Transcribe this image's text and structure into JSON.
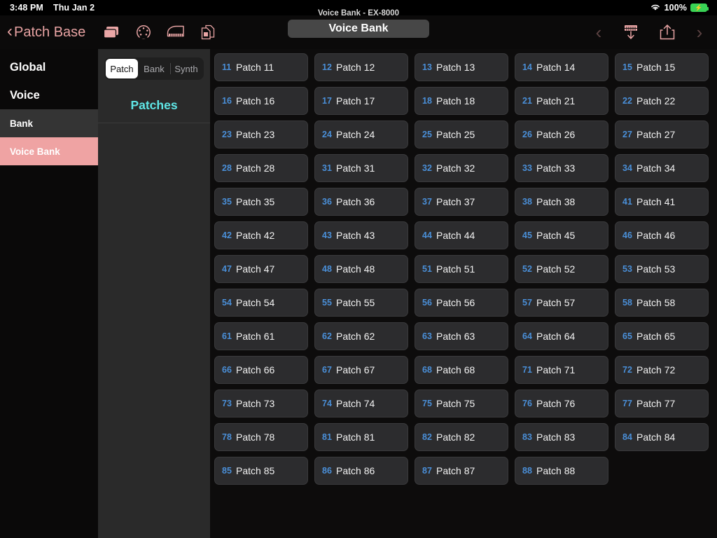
{
  "statusbar": {
    "time": "3:48 PM",
    "date": "Thu Jan 2",
    "wifi_icon": "wifi-icon",
    "battery_percent": "100%",
    "battery_icon": "battery-charging-icon",
    "battery_color": "#39d355"
  },
  "navbar": {
    "back_chevron": "‹",
    "back_label": "Patch Base",
    "back_color": "#e8a3a3",
    "icons": [
      {
        "name": "bank-cards-icon",
        "label": "Banks"
      },
      {
        "name": "midi-din-icon",
        "label": "MIDI"
      },
      {
        "name": "piano-icon",
        "label": "Keyboard"
      },
      {
        "name": "documents-icon",
        "label": "Files"
      }
    ],
    "subtitle": "Voice Bank - EX-8000",
    "title": "Voice Bank",
    "prev_chevron": "‹",
    "next_chevron": "›",
    "right_icons": [
      {
        "name": "receive-from-synth-icon",
        "label": "Receive"
      },
      {
        "name": "share-export-icon",
        "label": "Share"
      }
    ]
  },
  "sidebar": {
    "items": [
      {
        "label": "Global",
        "level": "top",
        "state": "normal"
      },
      {
        "label": "Voice",
        "level": "top",
        "state": "normal"
      },
      {
        "label": "Bank",
        "level": "sub",
        "state": "highlighted"
      },
      {
        "label": "Voice Bank",
        "level": "sub",
        "state": "selected"
      }
    ],
    "selected_color": "#efa3a3",
    "highlight_color": "#343434"
  },
  "midpanel": {
    "segments": [
      {
        "label": "Patch",
        "active": true
      },
      {
        "label": "Bank",
        "active": false
      },
      {
        "label": "Synth",
        "active": false
      }
    ],
    "section_title": "Patches",
    "section_title_color": "#5fe6e6"
  },
  "patches": [
    {
      "num": "11",
      "name": "Patch 11"
    },
    {
      "num": "12",
      "name": "Patch 12"
    },
    {
      "num": "13",
      "name": "Patch 13"
    },
    {
      "num": "14",
      "name": "Patch 14"
    },
    {
      "num": "15",
      "name": "Patch 15"
    },
    {
      "num": "16",
      "name": "Patch 16"
    },
    {
      "num": "17",
      "name": "Patch 17"
    },
    {
      "num": "18",
      "name": "Patch 18"
    },
    {
      "num": "21",
      "name": "Patch 21"
    },
    {
      "num": "22",
      "name": "Patch 22"
    },
    {
      "num": "23",
      "name": "Patch 23"
    },
    {
      "num": "24",
      "name": "Patch 24"
    },
    {
      "num": "25",
      "name": "Patch 25"
    },
    {
      "num": "26",
      "name": "Patch 26"
    },
    {
      "num": "27",
      "name": "Patch 27"
    },
    {
      "num": "28",
      "name": "Patch 28"
    },
    {
      "num": "31",
      "name": "Patch 31"
    },
    {
      "num": "32",
      "name": "Patch 32"
    },
    {
      "num": "33",
      "name": "Patch 33"
    },
    {
      "num": "34",
      "name": "Patch 34"
    },
    {
      "num": "35",
      "name": "Patch 35"
    },
    {
      "num": "36",
      "name": "Patch 36"
    },
    {
      "num": "37",
      "name": "Patch 37"
    },
    {
      "num": "38",
      "name": "Patch 38"
    },
    {
      "num": "41",
      "name": "Patch 41"
    },
    {
      "num": "42",
      "name": "Patch 42"
    },
    {
      "num": "43",
      "name": "Patch 43"
    },
    {
      "num": "44",
      "name": "Patch 44"
    },
    {
      "num": "45",
      "name": "Patch 45"
    },
    {
      "num": "46",
      "name": "Patch 46"
    },
    {
      "num": "47",
      "name": "Patch 47"
    },
    {
      "num": "48",
      "name": "Patch 48"
    },
    {
      "num": "51",
      "name": "Patch 51"
    },
    {
      "num": "52",
      "name": "Patch 52"
    },
    {
      "num": "53",
      "name": "Patch 53"
    },
    {
      "num": "54",
      "name": "Patch 54"
    },
    {
      "num": "55",
      "name": "Patch 55"
    },
    {
      "num": "56",
      "name": "Patch 56"
    },
    {
      "num": "57",
      "name": "Patch 57"
    },
    {
      "num": "58",
      "name": "Patch 58"
    },
    {
      "num": "61",
      "name": "Patch 61"
    },
    {
      "num": "62",
      "name": "Patch 62"
    },
    {
      "num": "63",
      "name": "Patch 63"
    },
    {
      "num": "64",
      "name": "Patch 64"
    },
    {
      "num": "65",
      "name": "Patch 65"
    },
    {
      "num": "66",
      "name": "Patch 66"
    },
    {
      "num": "67",
      "name": "Patch 67"
    },
    {
      "num": "68",
      "name": "Patch 68"
    },
    {
      "num": "71",
      "name": "Patch 71"
    },
    {
      "num": "72",
      "name": "Patch 72"
    },
    {
      "num": "73",
      "name": "Patch 73"
    },
    {
      "num": "74",
      "name": "Patch 74"
    },
    {
      "num": "75",
      "name": "Patch 75"
    },
    {
      "num": "76",
      "name": "Patch 76"
    },
    {
      "num": "77",
      "name": "Patch 77"
    },
    {
      "num": "78",
      "name": "Patch 78"
    },
    {
      "num": "81",
      "name": "Patch 81"
    },
    {
      "num": "82",
      "name": "Patch 82"
    },
    {
      "num": "83",
      "name": "Patch 83"
    },
    {
      "num": "84",
      "name": "Patch 84"
    },
    {
      "num": "85",
      "name": "Patch 85"
    },
    {
      "num": "86",
      "name": "Patch 86"
    },
    {
      "num": "87",
      "name": "Patch 87"
    },
    {
      "num": "88",
      "name": "Patch 88"
    }
  ]
}
